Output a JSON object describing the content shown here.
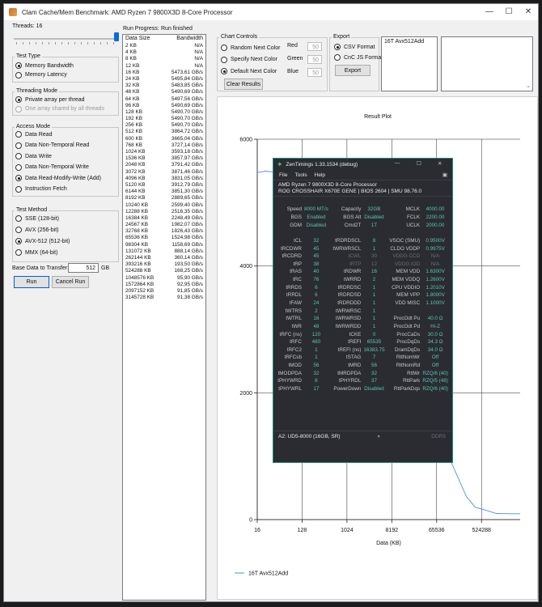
{
  "window": {
    "title": "Clam Cache/Mem Benchmark: AMD Ryzen 7 9800X3D 8-Core Processor",
    "min_glyph": "—",
    "max_glyph": "☐",
    "close_glyph": "✕"
  },
  "threads": {
    "label": "Threads: 16",
    "slider_fraction": 1.0
  },
  "test_type": {
    "title": "Test Type",
    "options": [
      "Memory Bandwidth",
      "Memory Latency"
    ],
    "selected": 0
  },
  "threading_mode": {
    "title": "Threading Mode",
    "options": [
      "Private array per thread",
      "One array shared by all threads"
    ],
    "selected": 0
  },
  "access_mode": {
    "title": "Access Mode",
    "options": [
      "Data Read",
      "Data Non-Temporal Read",
      "Data Write",
      "Data Non-Temporal Write",
      "Data Read-Modify-Write (Add)",
      "Instruction Fetch"
    ],
    "selected": 4
  },
  "test_method": {
    "title": "Test Method",
    "options": [
      "SSE (128-bit)",
      "AVX (256-bit)",
      "AVX-512 (512-bit)",
      "MMX (64-bit)"
    ],
    "selected": 2
  },
  "base_data": {
    "label": "Base Data to Transfer:",
    "value": "512",
    "unit": "GB"
  },
  "buttons": {
    "run": "Run",
    "cancel_run": "Cancel Run",
    "clear_results": "Clear Results",
    "export": "Export"
  },
  "progress": {
    "label": "Run Progress:",
    "status": "Run finished"
  },
  "results_table": {
    "headers": [
      "Data Size",
      "Bandwidth"
    ],
    "rows": [
      [
        "2 KB",
        "N/A"
      ],
      [
        "4 KB",
        "N/A"
      ],
      [
        "8 KB",
        "N/A"
      ],
      [
        "12 KB",
        "N/A"
      ],
      [
        "16 KB",
        "5473,61 GB/s"
      ],
      [
        "24 KB",
        "5495,84 GB/s"
      ],
      [
        "32 KB",
        "5483,85 GB/s"
      ],
      [
        "48 KB",
        "5490,69 GB/s"
      ],
      [
        "64 KB",
        "5497,56 GB/s"
      ],
      [
        "96 KB",
        "5490,69 GB/s"
      ],
      [
        "128 KB",
        "5490,70 GB/s"
      ],
      [
        "192 KB",
        "5490,70 GB/s"
      ],
      [
        "256 KB",
        "5490,70 GB/s"
      ],
      [
        "512 KB",
        "3864,72 GB/s"
      ],
      [
        "600 KB",
        "3665,04 GB/s"
      ],
      [
        "768 KB",
        "3727,14 GB/s"
      ],
      [
        "1024 KB",
        "3593,18 GB/s"
      ],
      [
        "1536 KB",
        "3857,97 GB/s"
      ],
      [
        "2048 KB",
        "3791,42 GB/s"
      ],
      [
        "3072 KB",
        "3871,46 GB/s"
      ],
      [
        "4096 KB",
        "3831,05 GB/s"
      ],
      [
        "5120 KB",
        "3912,79 GB/s"
      ],
      [
        "6144 KB",
        "3851,30 GB/s"
      ],
      [
        "8192 KB",
        "2889,65 GB/s"
      ],
      [
        "10240 KB",
        "2599,40 GB/s"
      ],
      [
        "12288 KB",
        "2516,35 GB/s"
      ],
      [
        "16384 KB",
        "2248,49 GB/s"
      ],
      [
        "24567 KB",
        "1982,07 GB/s"
      ],
      [
        "32768 KB",
        "1826,43 GB/s"
      ],
      [
        "65536 KB",
        "1524,98 GB/s"
      ],
      [
        "98304 KB",
        "1158,69 GB/s"
      ],
      [
        "131072 KB",
        "888,14 GB/s"
      ],
      [
        "262144 KB",
        "360,14 GB/s"
      ],
      [
        "393216 KB",
        "193,50 GB/s"
      ],
      [
        "524288 KB",
        "168,25 GB/s"
      ],
      [
        "1048576 KB",
        "95,90 GB/s"
      ],
      [
        "1572864 KB",
        "92,95 GB/s"
      ],
      [
        "2097152 KB",
        "91,85 GB/s"
      ],
      [
        "3145728 KB",
        "91,38 GB/s"
      ]
    ]
  },
  "chart_controls": {
    "title": "Chart Controls",
    "options": [
      "Random Next Color",
      "Specify Next Color",
      "Default Next Color"
    ],
    "selected": 2,
    "red_label": "Red",
    "red": "50",
    "green_label": "Green",
    "green": "50",
    "blue_label": "Blue",
    "blue": "50"
  },
  "export": {
    "title": "Export",
    "options": [
      "CSV Format",
      "CnC JS Format"
    ],
    "selected": 0
  },
  "runs_list": {
    "items": [
      "16T Avx512Add"
    ]
  },
  "chart_data": {
    "type": "line",
    "title": "Result Plot",
    "xlabel": "Data (KB)",
    "ylabel": "",
    "x_scale": "log",
    "x_ticks": [
      "16",
      "128",
      "1024",
      "8192",
      "65536",
      "524288"
    ],
    "y_ticks": [
      "0",
      "2000",
      "4000",
      "6000"
    ],
    "ylim": [
      0,
      6000
    ],
    "grid": true,
    "legend_position": "bottom-left",
    "color": "#4a90e2",
    "series": [
      {
        "name": "16T Avx512Add",
        "x": [
          16,
          24,
          32,
          48,
          64,
          96,
          128,
          192,
          256,
          512,
          600,
          768,
          1024,
          1536,
          2048,
          3072,
          4096,
          5120,
          6144,
          8192,
          10240,
          12288,
          16384,
          24567,
          32768,
          65536,
          98304,
          131072,
          262144,
          393216,
          524288,
          1048576,
          1572864,
          2097152,
          3145728
        ],
        "y": [
          5473.61,
          5495.84,
          5483.85,
          5490.69,
          5497.56,
          5490.69,
          5490.7,
          5490.7,
          5490.7,
          3864.72,
          3665.04,
          3727.14,
          3593.18,
          3857.97,
          3791.42,
          3871.46,
          3831.05,
          3912.79,
          3851.3,
          2889.65,
          2599.4,
          2516.35,
          2248.49,
          1982.07,
          1826.43,
          1524.98,
          1158.69,
          888.14,
          360.14,
          193.5,
          168.25,
          95.9,
          92.95,
          91.85,
          91.38
        ]
      }
    ]
  },
  "zentimings": {
    "title": "ZenTimings 1.33.1534 (debug)",
    "menu": [
      "File",
      "Tools",
      "Help"
    ],
    "cpu": "AMD Ryzen 7 9800X3D 8-Core Processor",
    "board": "ROG CROSSHAIR X670E GENE | BIOS 2604 | SMU 98.76.0",
    "rows": [
      [
        "Speed",
        "8000 MT/s",
        "Capacity",
        "32GB",
        "MCLK",
        "4000.00"
      ],
      [
        "BGS",
        "Enabled",
        "BGS Alt",
        "Disabled",
        "FCLK",
        "2200.00"
      ],
      [
        "GDM",
        "Disabled",
        "Cmd2T",
        "1T",
        "UCLK",
        "2000.00"
      ],
      [
        "",
        "",
        "",
        "",
        "",
        ""
      ],
      [
        "tCL",
        "32",
        "tRDRDSCL",
        "8",
        "VSOC (SMU)",
        "0.9500V"
      ],
      [
        "tRCDWR",
        "45",
        "tWRWRSCL",
        "1",
        "CLDO VDDP",
        "0.9975V"
      ],
      [
        "tRCDRD",
        "45",
        "tCWL",
        "30",
        "VDDG CCD",
        "N/A"
      ],
      [
        "tRP",
        "38",
        "tRTP",
        "12",
        "VDDG IOD",
        "N/A"
      ],
      [
        "tRAS",
        "40",
        "tRDWR",
        "16",
        "MEM VDD",
        "1.6300V"
      ],
      [
        "tRC",
        "76",
        "tWRRD",
        "2",
        "MEM VDDQ",
        "1.2600V"
      ],
      [
        "tRRDS",
        "6",
        "tRDRDSC",
        "1",
        "CPU VDDIO",
        "1.2010V"
      ],
      [
        "tRRDL",
        "6",
        "tRDRDSD",
        "1",
        "MEM VPP",
        "1.8000V"
      ],
      [
        "tFAW",
        "24",
        "tRDRDDD",
        "1",
        "VDD MISC",
        "1.1000V"
      ],
      [
        "tWTRS",
        "2",
        "tWRWRSC",
        "1",
        "",
        ""
      ],
      [
        "tWTRL",
        "16",
        "tWRWRSD",
        "1",
        "ProcOdt Pu",
        "40.0 Ω"
      ],
      [
        "tWR",
        "48",
        "tWRWRDD",
        "1",
        "ProcOdt Pd",
        "Hi-Z"
      ],
      [
        "tRFC (ns)",
        "120",
        "tCKE",
        "0",
        "ProcCaDs",
        "30.0 Ω"
      ],
      [
        "tRFC",
        "480",
        "tREFI",
        "65535",
        "ProcDqDs",
        "34.3 Ω"
      ],
      [
        "tRFC2",
        "1",
        "tREFI (ns)",
        "16383.75",
        "DramDqDs",
        "34.0 Ω"
      ],
      [
        "tRFCsb",
        "1",
        "tSTAG",
        "7",
        "RttNomWr",
        "Off"
      ],
      [
        "tMOD",
        "56",
        "tMRD",
        "56",
        "RttNomRd",
        "Off"
      ],
      [
        "tMODPDA",
        "32",
        "tMRDPDA",
        "32",
        "RttWr",
        "RZQ/6 (40)"
      ],
      [
        "tPHYWRD",
        "6",
        "tPHYRDL",
        "37",
        "RttPark",
        "RZQ/5 (48)"
      ],
      [
        "tPHYWRL",
        "17",
        "PowerDown",
        "Disabled",
        "RttParkDqs",
        "RZQ/6 (40)"
      ]
    ],
    "dim_values": [
      "tCWL",
      "tRTP",
      "VDDG CCD",
      "VDDG IOD"
    ],
    "profile": "A2: UD5-8000 (16GB, SR)",
    "dimm_button": "DDR5",
    "min_glyph": "—",
    "max_glyph": "☐",
    "close_glyph": "✕"
  }
}
